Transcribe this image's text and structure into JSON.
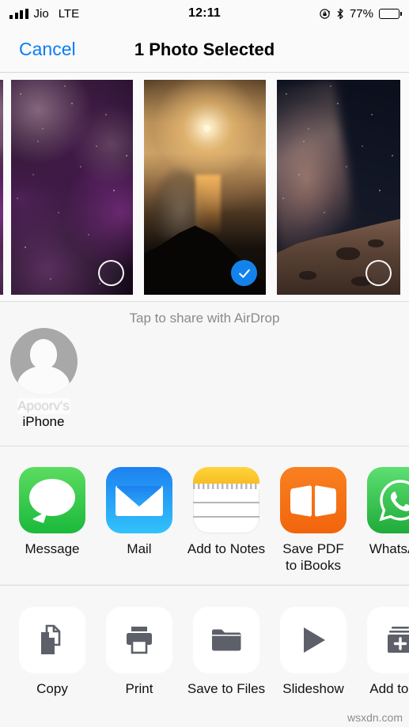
{
  "status_bar": {
    "carrier": "Jio",
    "network": "LTE",
    "time": "12:11",
    "battery_percent": "77%",
    "icons": [
      "signal-bars-icon",
      "rotation-lock-icon",
      "bluetooth-icon",
      "battery-icon"
    ]
  },
  "nav_bar": {
    "cancel_label": "Cancel",
    "title": "1 Photo Selected"
  },
  "photo_strip": {
    "photos": [
      {
        "id": "photo-nebula",
        "alt": "purple nebula starfield",
        "selected": false
      },
      {
        "id": "photo-sunset",
        "alt": "sunset over volcano and sea",
        "selected": true
      },
      {
        "id": "photo-milkyway",
        "alt": "milky way over mountain ridge",
        "selected": false
      }
    ],
    "selected_count": 1
  },
  "airdrop": {
    "hint": "Tap to share with AirDrop",
    "target": {
      "owner": "Apoorv's",
      "device": "iPhone"
    }
  },
  "apps": [
    {
      "name": "Message",
      "label": "Message",
      "icon": "message-bubble-icon",
      "color": "#1ab93c"
    },
    {
      "name": "Mail",
      "label": "Mail",
      "icon": "mail-envelope-icon",
      "color": "#2ba6f6"
    },
    {
      "name": "Notes",
      "label": "Add to Notes",
      "icon": "notes-icon",
      "color": "#f8bd24"
    },
    {
      "name": "iBooks",
      "label": "Save PDF\nto iBooks",
      "icon": "book-icon",
      "color": "#f2640d"
    },
    {
      "name": "WhatsApp",
      "label": "WhatsApp",
      "icon": "whatsapp-icon",
      "color": "#1fab3a"
    }
  ],
  "actions": [
    {
      "name": "copy",
      "label": "Copy",
      "icon": "copy-documents-icon"
    },
    {
      "name": "print",
      "label": "Print",
      "icon": "printer-icon"
    },
    {
      "name": "save-to-files",
      "label": "Save to Files",
      "icon": "folder-icon"
    },
    {
      "name": "slideshow",
      "label": "Slideshow",
      "icon": "play-triangle-icon"
    },
    {
      "name": "add-to-album",
      "label": "Add to Alb",
      "icon": "album-plus-icon"
    }
  ],
  "watermark": "wsxdn.com",
  "colors": {
    "accent_blue": "#0b7cf7",
    "selection_blue": "#1383eb",
    "background": "#f7f7f7",
    "bar_background": "#fafafa"
  }
}
